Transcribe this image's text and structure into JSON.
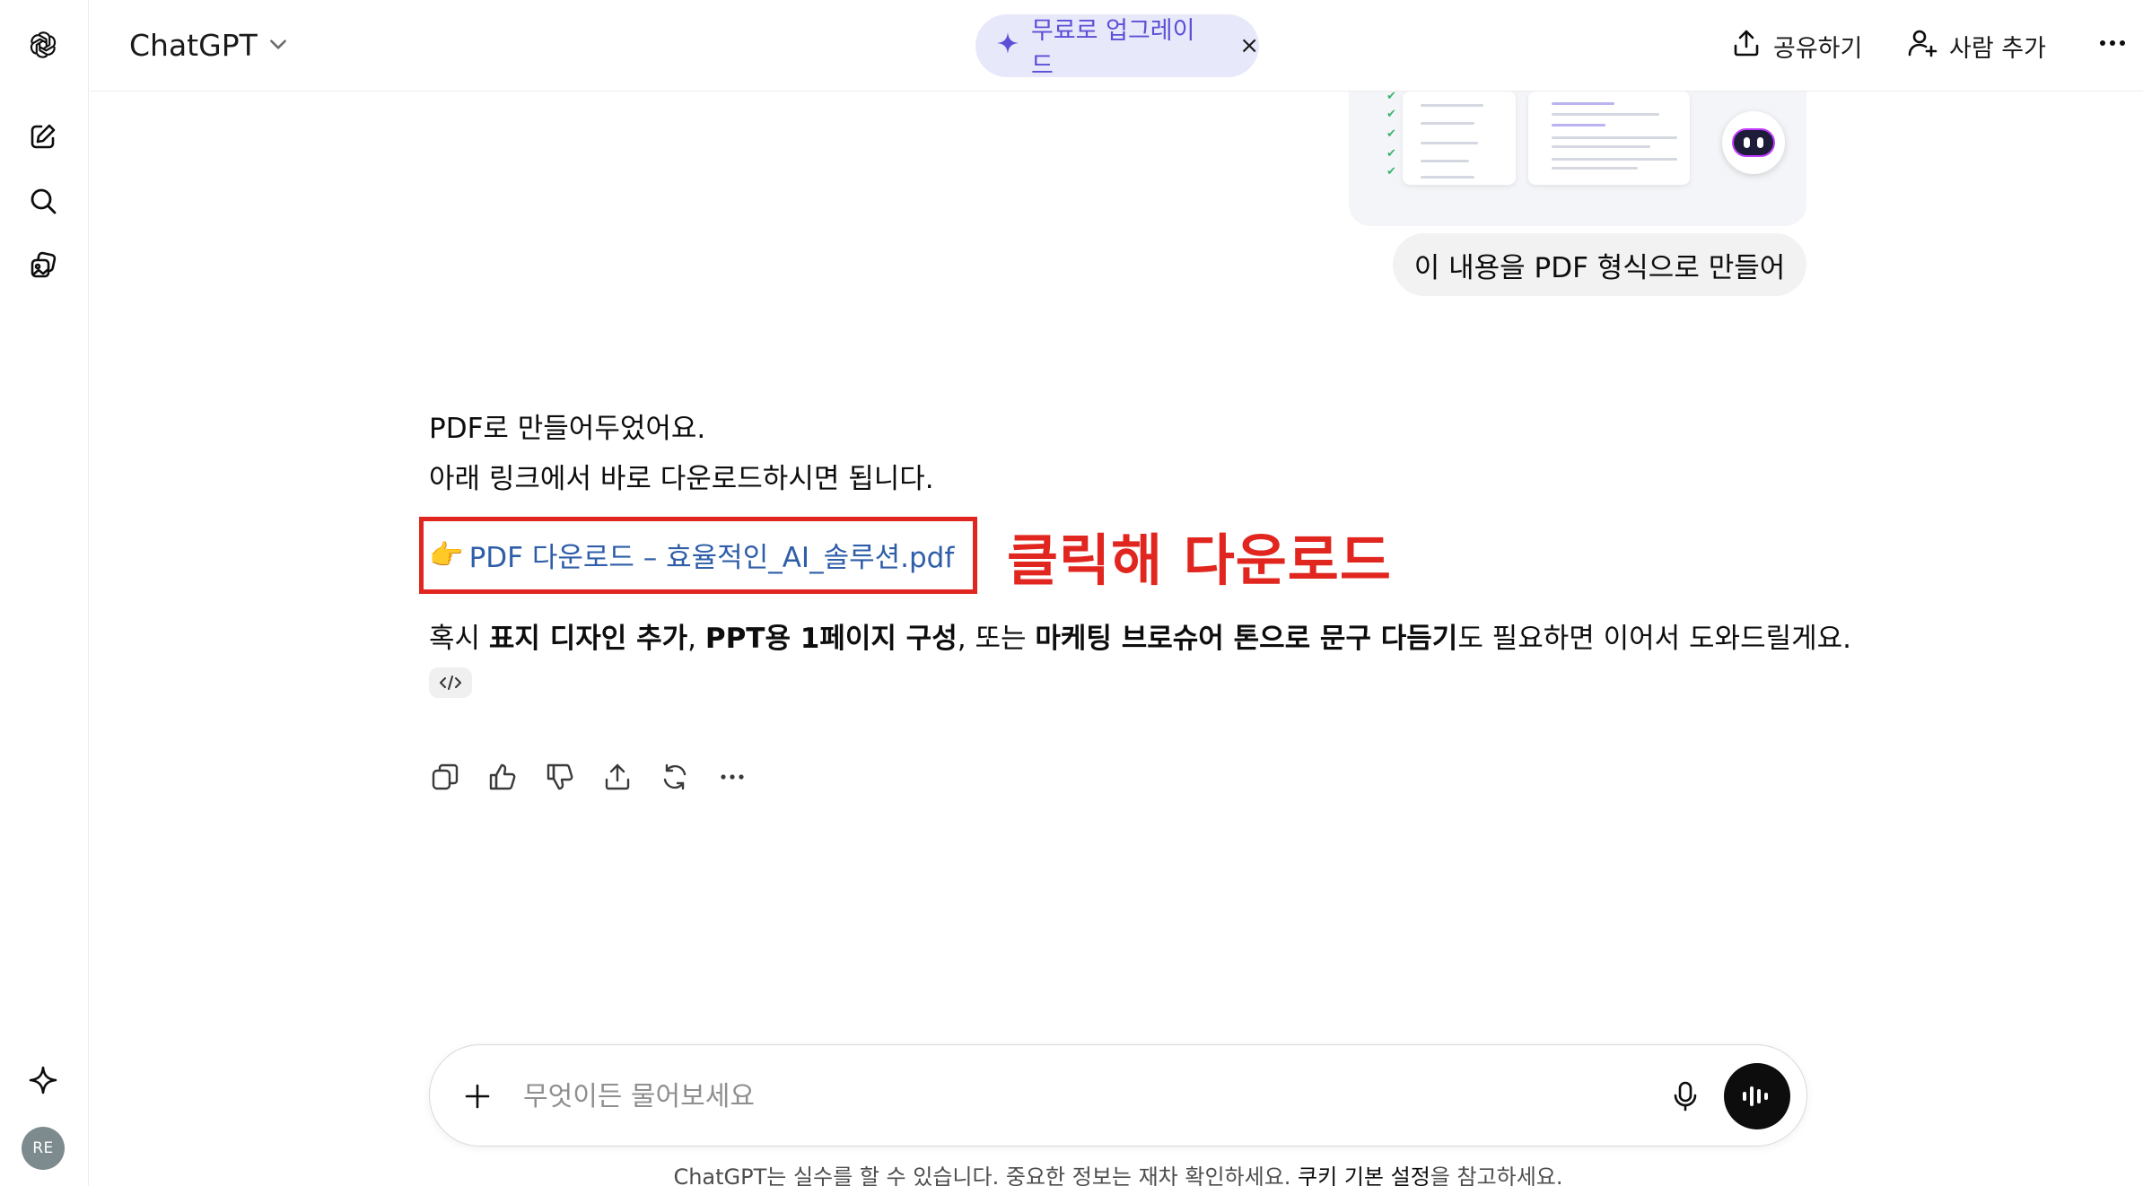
{
  "header": {
    "model_name": "ChatGPT",
    "upgrade_label": "무료로 업그레이드",
    "upgrade_close": "×",
    "share_label": "공유하기",
    "add_people_label": "사람 추가"
  },
  "sidebar": {
    "avatar_initials": "RE"
  },
  "chat": {
    "user_message": "이 내용을 PDF 형식으로 만들어",
    "assistant": {
      "line1": "PDF로 만들어두었어요.",
      "line2": "아래 링크에서 바로 다운로드하시면 됩니다.",
      "link_emoji": "👉",
      "link_text": "PDF 다운로드 – 효율적인_AI_솔루션.pdf",
      "annotation": "클릭해 다운로드",
      "suggestion": {
        "p1": "혹시 ",
        "b1": "표지 디자인 추가",
        "p2": ", ",
        "b2": "PPT용 1페이지 구성",
        "p3": ", 또는 ",
        "b3": "마케팅 브로슈어 톤으로 문구 다듬기",
        "p4": "도 필요하면 이어서 도와드릴게요."
      }
    }
  },
  "composer": {
    "placeholder": "무엇이든 물어보세요"
  },
  "disclaimer": {
    "before": "ChatGPT는 실수를 할 수 있습니다. 중요한 정보는 재차 확인하세요. ",
    "link": "쿠키 기본 설정",
    "after": "을 참고하세요."
  },
  "colors": {
    "annotation_red": "#e0261f",
    "link_blue": "#2f5ea8",
    "upgrade_bg": "#e8e8fb",
    "upgrade_text": "#5b4fd6"
  }
}
